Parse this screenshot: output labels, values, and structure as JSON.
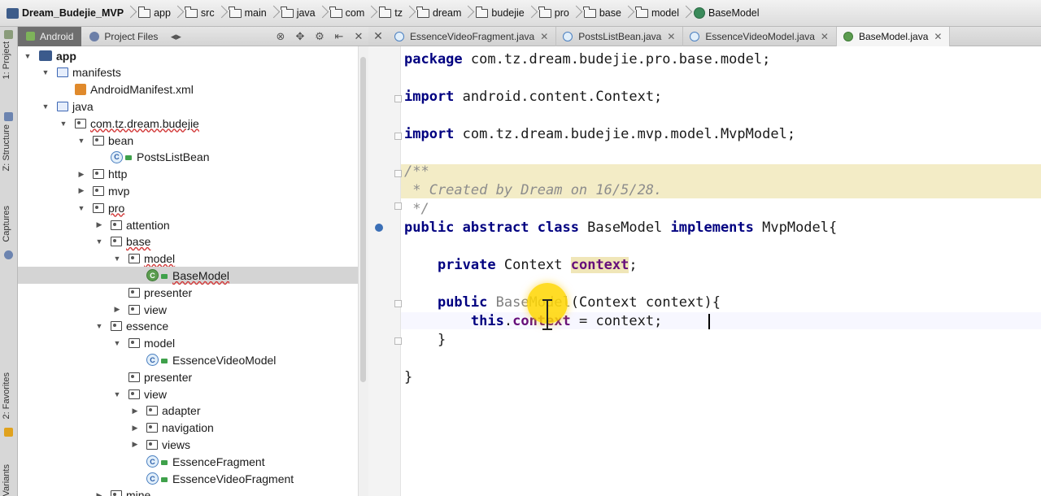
{
  "breadcrumbs": [
    "Dream_Budejie_MVP",
    "app",
    "src",
    "main",
    "java",
    "com",
    "tz",
    "dream",
    "budejie",
    "pro",
    "base",
    "model",
    "BaseModel"
  ],
  "tool_strip": {
    "project": "1: Project",
    "structure": "Z: Structure",
    "captures": "Captures",
    "favorites": "2: Favorites",
    "variants": "Build Variants"
  },
  "project_panel": {
    "tab_android": "Android",
    "tab_project_files": "Project Files"
  },
  "tree": [
    {
      "label": "app",
      "depth": 0,
      "arrow": "open",
      "icon": "module"
    },
    {
      "label": "manifests",
      "depth": 1,
      "arrow": "open",
      "icon": "folder-blue"
    },
    {
      "label": "AndroidManifest.xml",
      "depth": 2,
      "arrow": "none",
      "icon": "xml"
    },
    {
      "label": "java",
      "depth": 1,
      "arrow": "open",
      "icon": "folder-blue"
    },
    {
      "label": "com.tz.dream.budejie",
      "depth": 2,
      "arrow": "open",
      "icon": "package"
    },
    {
      "label": "bean",
      "depth": 3,
      "arrow": "open",
      "icon": "package"
    },
    {
      "label": "PostsListBean",
      "depth": 4,
      "arrow": "none",
      "icon": "class"
    },
    {
      "label": "http",
      "depth": 3,
      "arrow": "closed",
      "icon": "package"
    },
    {
      "label": "mvp",
      "depth": 3,
      "arrow": "closed",
      "icon": "package"
    },
    {
      "label": "pro",
      "depth": 3,
      "arrow": "open",
      "icon": "package"
    },
    {
      "label": "attention",
      "depth": 4,
      "arrow": "closed",
      "icon": "package"
    },
    {
      "label": "base",
      "depth": 4,
      "arrow": "open",
      "icon": "package"
    },
    {
      "label": "model",
      "depth": 5,
      "arrow": "open",
      "icon": "package"
    },
    {
      "label": "BaseModel",
      "depth": 6,
      "arrow": "none",
      "icon": "abstract-class",
      "selected": true
    },
    {
      "label": "presenter",
      "depth": 5,
      "arrow": "none",
      "icon": "package"
    },
    {
      "label": "view",
      "depth": 5,
      "arrow": "closed",
      "icon": "package"
    },
    {
      "label": "essence",
      "depth": 4,
      "arrow": "open",
      "icon": "package"
    },
    {
      "label": "model",
      "depth": 5,
      "arrow": "open",
      "icon": "package"
    },
    {
      "label": "EssenceVideoModel",
      "depth": 6,
      "arrow": "none",
      "icon": "class"
    },
    {
      "label": "presenter",
      "depth": 5,
      "arrow": "none",
      "icon": "package"
    },
    {
      "label": "view",
      "depth": 5,
      "arrow": "open",
      "icon": "package"
    },
    {
      "label": "adapter",
      "depth": 6,
      "arrow": "closed",
      "icon": "package"
    },
    {
      "label": "navigation",
      "depth": 6,
      "arrow": "closed",
      "icon": "package"
    },
    {
      "label": "views",
      "depth": 6,
      "arrow": "closed",
      "icon": "package"
    },
    {
      "label": "EssenceFragment",
      "depth": 6,
      "arrow": "none",
      "icon": "class"
    },
    {
      "label": "EssenceVideoFragment",
      "depth": 6,
      "arrow": "none",
      "icon": "class"
    },
    {
      "label": "mine",
      "depth": 4,
      "arrow": "closed",
      "icon": "package"
    }
  ],
  "editor_tabs": [
    {
      "label": "EssenceVideoFragment.java",
      "active": false
    },
    {
      "label": "PostsListBean.java",
      "active": false
    },
    {
      "label": "EssenceVideoModel.java",
      "active": false
    },
    {
      "label": "BaseModel.java",
      "active": true
    }
  ],
  "code": {
    "l1_kw": "package",
    "l1_rest": " com.tz.dream.budejie.pro.base.model;",
    "l2_kw": "import",
    "l2_rest": " android.content.Context;",
    "l3_kw": "import",
    "l3_rest": " com.tz.dream.budejie.mvp.model.MvpModel;",
    "c1": "/**",
    "c2": " * Created by Dream on 16/5/28.",
    "c3": " */",
    "cls_kw1": "public abstract class",
    "cls_name": " BaseModel ",
    "cls_kw2": "implements",
    "cls_rest": " MvpModel{",
    "field_kw": "private",
    "field_type": " Context ",
    "field_name": "context",
    "field_end": ";",
    "ctor_kw": "public",
    "ctor_name": " BaseModel",
    "ctor_rest": "(Context context){",
    "assign_kw": "this",
    "assign_dot": ".",
    "assign_field": "context",
    "assign_rest": " = context;",
    "close_inner": "}",
    "close_outer": "}"
  }
}
